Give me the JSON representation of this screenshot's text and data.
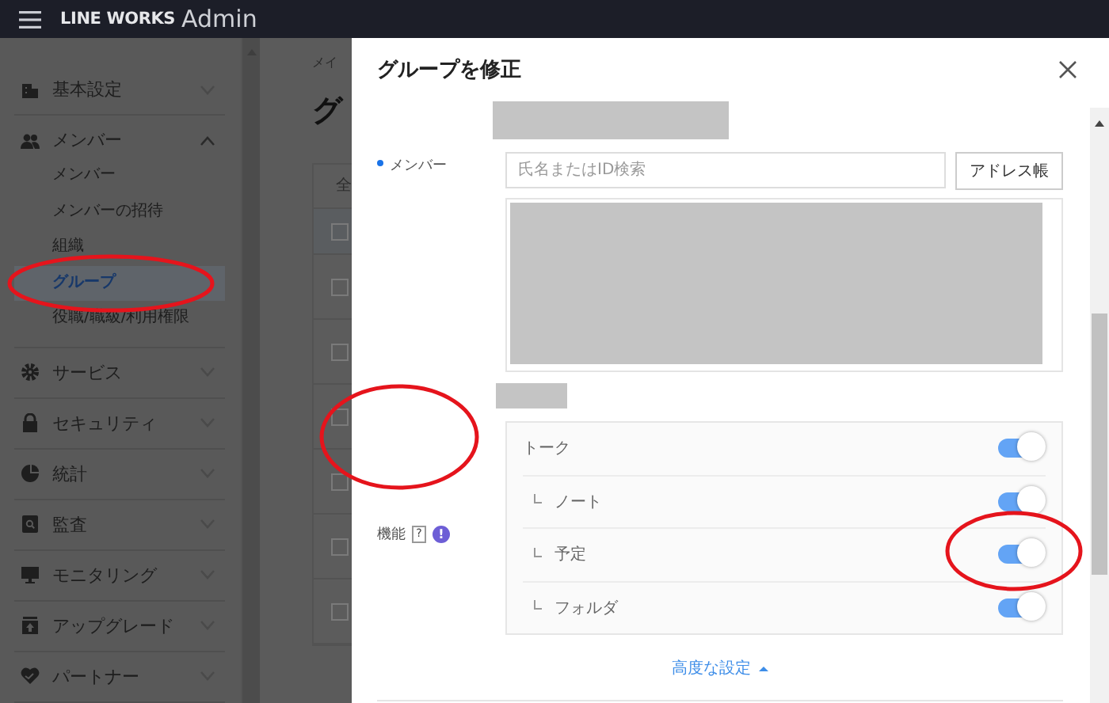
{
  "header": {
    "logo": "LINE WORKS",
    "product": "Admin"
  },
  "sidebar": {
    "items": [
      {
        "label": "基本設定",
        "expanded": false
      },
      {
        "label": "メンバー",
        "expanded": true,
        "children": [
          {
            "label": "メンバー",
            "selected": false
          },
          {
            "label": "メンバーの招待",
            "selected": false
          },
          {
            "label": "組織",
            "selected": false
          },
          {
            "label": "グループ",
            "selected": true
          },
          {
            "label": "役職/職級/利用権限",
            "selected": false
          }
        ]
      },
      {
        "label": "サービス",
        "expanded": false
      },
      {
        "label": "セキュリティ",
        "expanded": false
      },
      {
        "label": "統計",
        "expanded": false
      },
      {
        "label": "監査",
        "expanded": false
      },
      {
        "label": "モニタリング",
        "expanded": false
      },
      {
        "label": "アップグレード",
        "expanded": false
      },
      {
        "label": "パートナー",
        "expanded": false
      }
    ]
  },
  "main": {
    "breadcrumb": "メイ",
    "heading": "グ",
    "table": {
      "column_1": "全",
      "rows": [
        {
          "checked": false
        },
        {
          "checked": false
        },
        {
          "checked": false
        },
        {
          "checked": false
        },
        {
          "checked": false
        },
        {
          "checked": false
        },
        {
          "checked": false
        }
      ]
    }
  },
  "dialog": {
    "title": "グループを修正",
    "member": {
      "label": "メンバー",
      "required": true,
      "search": {
        "placeholder": "氏名またはID検索"
      },
      "button": "アドレス帳"
    },
    "features": {
      "label": "機能",
      "help": "?",
      "info": "!",
      "items": [
        {
          "label": "トーク",
          "on": true,
          "children": [
            {
              "label": "ノート",
              "on": true
            },
            {
              "label": "予定",
              "on": true
            },
            {
              "label": "フォルダ",
              "on": true
            }
          ]
        }
      ]
    },
    "advanced": {
      "label": "高度な設定",
      "expanded": true
    }
  }
}
